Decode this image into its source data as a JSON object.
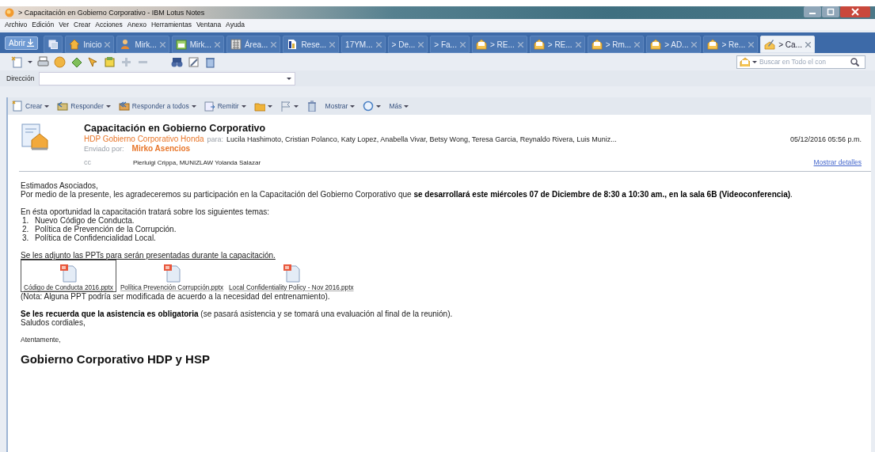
{
  "window": {
    "title": "> Capacitación en Gobierno Corporativo - IBM Lotus Notes"
  },
  "menu": [
    "Archivo",
    "Edición",
    "Ver",
    "Crear",
    "Acciones",
    "Anexo",
    "Herramientas",
    "Ventana",
    "Ayuda"
  ],
  "open_button": "Abrir",
  "tabs": [
    {
      "label": "Inicio",
      "kind": "home",
      "selected": false
    },
    {
      "label": "Mirk...",
      "kind": "person",
      "selected": false
    },
    {
      "label": "Mirk...",
      "kind": "calendar",
      "selected": false
    },
    {
      "label": "Área...",
      "kind": "agenda",
      "selected": false
    },
    {
      "label": "Rese...",
      "kind": "doc",
      "selected": false
    },
    {
      "label": "17YM...",
      "kind": "plain",
      "selected": false
    },
    {
      "label": "> De...",
      "kind": "plain",
      "selected": false
    },
    {
      "label": "> Fa...",
      "kind": "plain",
      "selected": false
    },
    {
      "label": "> RE...",
      "kind": "mail",
      "selected": false
    },
    {
      "label": "> RE...",
      "kind": "mail",
      "selected": false
    },
    {
      "label": "> Rm...",
      "kind": "mail",
      "selected": false
    },
    {
      "label": "> AD...",
      "kind": "mail",
      "selected": false
    },
    {
      "label": "> Re...",
      "kind": "mail",
      "selected": false
    },
    {
      "label": "> Ca...",
      "kind": "editing",
      "selected": true
    }
  ],
  "search": {
    "placeholder": "Buscar en Todo el con"
  },
  "address": {
    "label": "Dirección"
  },
  "actions": [
    {
      "label": "Crear",
      "kind": "new",
      "dropdown": true
    },
    {
      "label": "Responder",
      "kind": "reply",
      "dropdown": true
    },
    {
      "label": "Responder a todos",
      "kind": "replyall",
      "dropdown": true
    },
    {
      "label": "Remitir",
      "kind": "forward",
      "dropdown": true
    },
    {
      "kind": "folder",
      "dropdown": true
    },
    {
      "kind": "flag",
      "dropdown": true
    },
    {
      "kind": "trash",
      "dropdown": false
    },
    {
      "label": "Mostrar",
      "kind": "plain",
      "dropdown": true
    },
    {
      "kind": "search",
      "dropdown": true
    },
    {
      "label": "Más",
      "kind": "plain",
      "dropdown": true
    }
  ],
  "message": {
    "subject": "Capacitación en Gobierno Corporativo",
    "from": "HDP Gobierno Corporativo Honda",
    "to_label": "para:",
    "to": "Lucila Hashimoto, Cristian Polanco, Katy Lopez, Anabella Vivar, Betsy Wong, Teresa Garcia, Reynaldo Rivera, Luis Muniz...",
    "date": "05/12/2016 05:56 p.m.",
    "sent_by_label": "Enviado por:",
    "sent_by": "Mirko Asencios",
    "cc_label": "cc",
    "cc": "Pierluigi Crippa, MUNIZLAW Yolanda Salazar",
    "details_link": "Mostrar detalles"
  },
  "body": {
    "greeting": "Estimados Asociados,",
    "intro": "Por medio de la presente, les agradeceremos su participación en la Capacitación del Gobierno Corporativo que **se desarrollará este miércoles 07 de Diciembre de 8:30 a 10:30 am., en la sala 6B (Videoconferencia)**.",
    "topics_intro": "En ésta oportunidad la capacitación tratará sobre los siguientes temas:",
    "topics": [
      {
        "number": "1.",
        "text": "Nuevo Código de Conducta."
      },
      {
        "number": "2.",
        "text": "Política de Prevención de la Corrupción."
      },
      {
        "number": "3.",
        "text": "Política de Confidencialidad Local."
      }
    ],
    "attachments_intro": "Se les adjunto las PPTs para serán presentadas durante la capacitación.",
    "attachments": [
      {
        "name": "Código de Conducta 2016.pptx",
        "selected": true
      },
      {
        "name": "Política Prevención Corrupción.pptx",
        "selected": false
      },
      {
        "name": "Local Confidentiality Policy - Nov 2016.pptx",
        "selected": false
      }
    ],
    "note": "(Nota: Alguna PPT podría ser modificada de acuerdo a la necesidad del entrenamiento).",
    "reminder": "**Se les recuerda que la asistencia es obligatoria** (se pasará asistencia y se tomará una evaluación al final de la reunión).",
    "closing": "Saludos cordiales,",
    "sign_off": "Atentamente,",
    "signature": "Gobierno Corporativo HDP y HSP"
  }
}
